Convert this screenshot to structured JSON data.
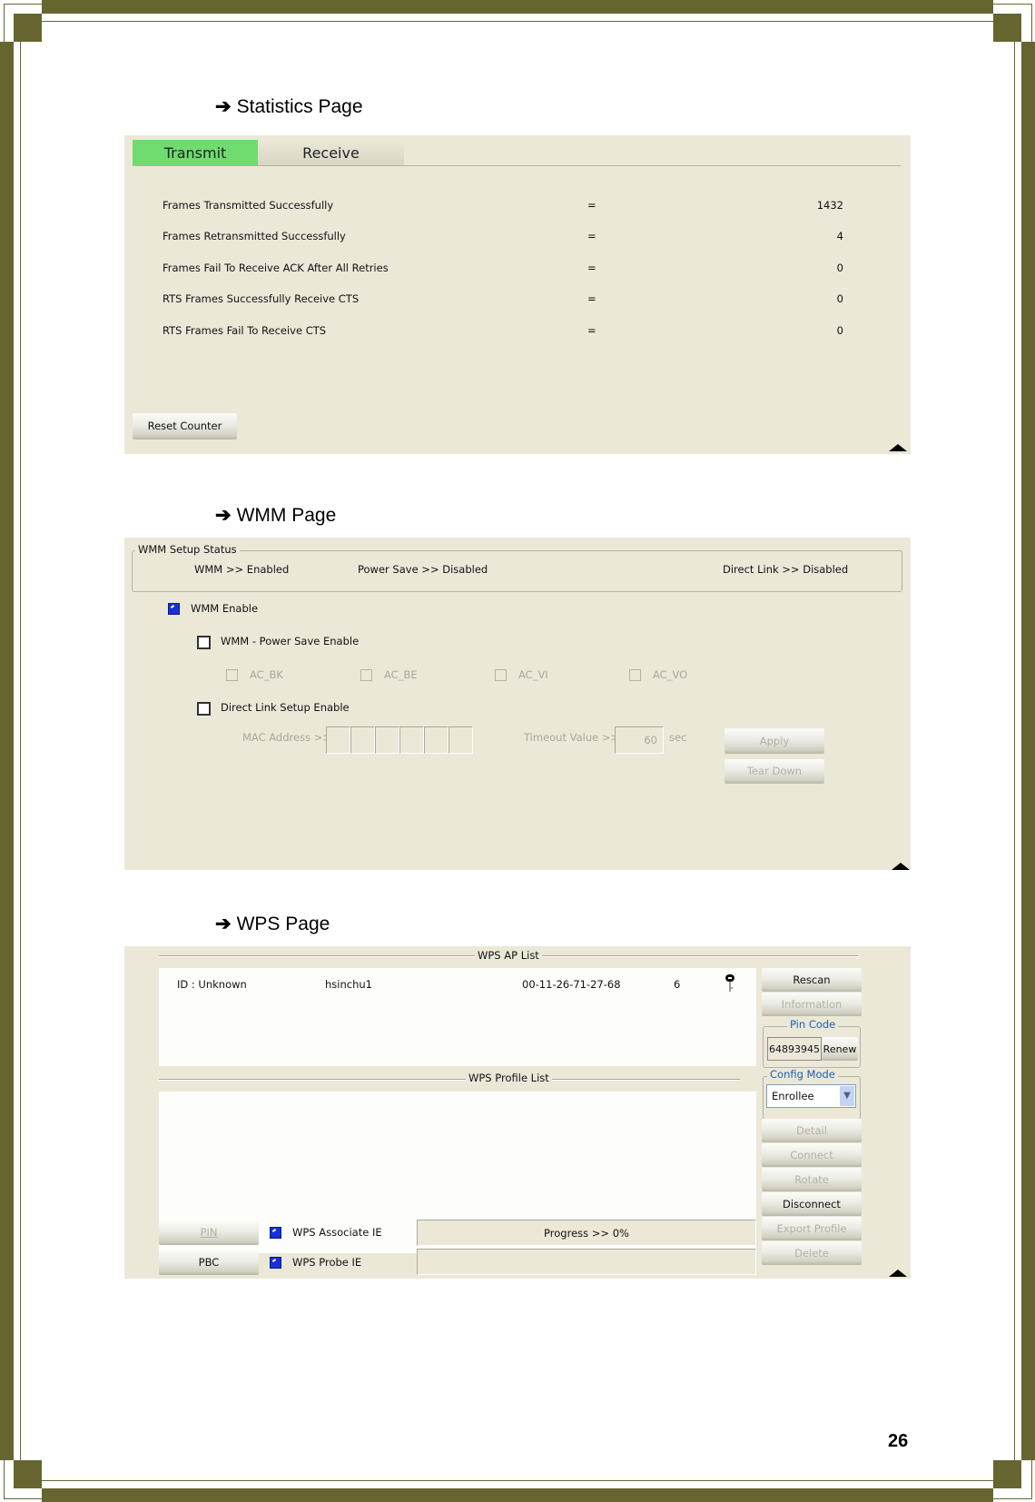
{
  "page": {
    "number": "26"
  },
  "sections": {
    "statistics": {
      "heading": "Statistics Page"
    },
    "wmm": {
      "heading": "WMM Page"
    },
    "wps": {
      "heading": "WPS Page"
    }
  },
  "statistics": {
    "tabs": [
      {
        "label": "Transmit",
        "active": true
      },
      {
        "label": "Receive",
        "active": false
      }
    ],
    "rows": [
      {
        "label": "Frames Transmitted Successfully",
        "sep": "=",
        "value": "1432"
      },
      {
        "label": "Frames Retransmitted Successfully",
        "sep": "=",
        "value": "4"
      },
      {
        "label": "Frames Fail To Receive ACK After All Retries",
        "sep": "=",
        "value": "0"
      },
      {
        "label": "RTS Frames Successfully Receive CTS",
        "sep": "=",
        "value": "0"
      },
      {
        "label": "RTS Frames Fail To Receive CTS",
        "sep": "=",
        "value": "0"
      }
    ],
    "reset_button": "Reset Counter",
    "active_tab_color": "#6fdc6f"
  },
  "wmm": {
    "status_group": "WMM Setup Status",
    "status": {
      "wmm": "WMM >> Enabled",
      "power_save": "Power Save >> Disabled",
      "direct_link": "Direct Link >> Disabled"
    },
    "wmm_enable": {
      "label": "WMM Enable",
      "checked": true
    },
    "power_save_enable": {
      "label": "WMM - Power Save Enable",
      "checked": false
    },
    "ac": [
      {
        "label": "AC_BK",
        "checked": false
      },
      {
        "label": "AC_BE",
        "checked": false
      },
      {
        "label": "AC_VI",
        "checked": false
      },
      {
        "label": "AC_VO",
        "checked": false
      }
    ],
    "direct_link_enable": {
      "label": "Direct Link Setup Enable",
      "checked": false
    },
    "mac_label": "MAC Address >>",
    "mac_fields": [
      "",
      "",
      "",
      "",
      "",
      ""
    ],
    "timeout_label": "Timeout Value >>",
    "timeout_value": "60",
    "timeout_unit": "sec",
    "apply_button": "Apply",
    "teardown_button": "Tear Down"
  },
  "wps": {
    "ap_list_title": "WPS AP List",
    "ap_list": [
      {
        "id": "ID : Unknown",
        "ssid": "hsinchu1",
        "bssid": "00-11-26-71-27-68",
        "channel": "6",
        "icon": "key-icon"
      }
    ],
    "profile_list_title": "WPS Profile List",
    "buttons": {
      "rescan": "Rescan",
      "information": "Information",
      "renew": "Renew",
      "detail": "Detail",
      "connect": "Connect",
      "rotate": "Rotate",
      "disconnect": "Disconnect",
      "export_profile": "Export Profile",
      "delete": "Delete",
      "pin": "PIN",
      "pbc": "PBC"
    },
    "pin_code_label": "Pin Code",
    "pin_code": "64893945",
    "config_mode_label": "Config Mode",
    "config_mode": "Enrollee",
    "associate_ie": {
      "label": "WPS Associate IE",
      "checked": true
    },
    "probe_ie": {
      "label": "WPS Probe IE",
      "checked": true
    },
    "progress_text": "Progress >> 0%",
    "progress": 0,
    "group_label_color": "#1f5fb0"
  }
}
